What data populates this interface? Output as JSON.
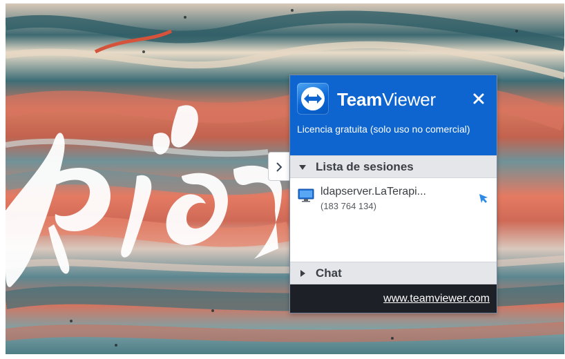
{
  "window": {
    "app_name_bold": "Team",
    "app_name_regular": "Viewer",
    "license_text": "Licencia gratuita (solo uso no comercial)",
    "close_icon": "close-icon",
    "logo_icon": "teamviewer-logo-icon"
  },
  "sessions": {
    "header_label": "Lista de sesiones",
    "expanded": true,
    "items": [
      {
        "name": "ldapserver.LaTerapi...",
        "id": "(183 764 134)",
        "icon": "monitor-icon",
        "action_icon": "connect-arrow-icon"
      }
    ]
  },
  "chat": {
    "header_label": "Chat",
    "expanded": false
  },
  "footer": {
    "link_text": "www.teamviewer.com"
  },
  "collapse_tab": {
    "icon": "chevron-right-icon"
  },
  "colors": {
    "brand_blue": "#0e65cf",
    "footer_dark": "#1d2027",
    "section_gray": "#e4e6ea"
  }
}
